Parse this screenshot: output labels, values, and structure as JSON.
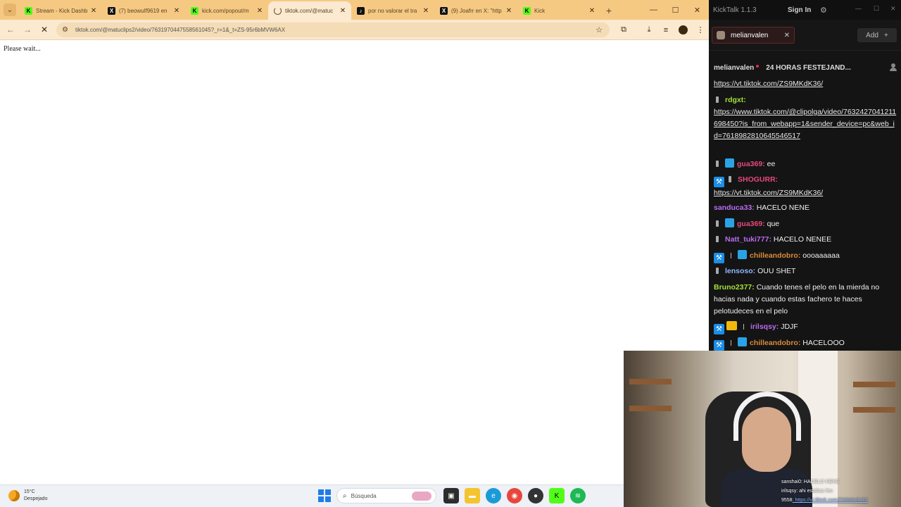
{
  "browser": {
    "tabs": [
      {
        "label": "Stream - Kick Dashb",
        "icon": "kick-icon"
      },
      {
        "label": "(7) beowulf9619 en",
        "icon": "x-icon"
      },
      {
        "label": "kick.com/popout/m",
        "icon": "kick-icon"
      },
      {
        "label": "tiktok.com/@matuc",
        "icon": "loading-icon",
        "active": true
      },
      {
        "label": "por no valorar el tra",
        "icon": "tiktok-icon"
      },
      {
        "label": "(9) Joafrr en X: \"http",
        "icon": "x-icon"
      },
      {
        "label": "Kick",
        "icon": "kick-icon"
      }
    ],
    "url": "tiktok.com/@matuclips2/video/7631970447558561045?_r=1&_t=ZS-95r6bMVW6AX",
    "page_text": "Please wait..."
  },
  "taskbar": {
    "weather_temp": "15°C",
    "weather_desc": "Despejado",
    "search_placeholder": "Búsqueda"
  },
  "kicktalk": {
    "app_title": "KickTalk 1.1.3",
    "sign_in": "Sign In",
    "channel_tab": "melianvalen",
    "add_label": "Add",
    "stream_channel": "melianvalen",
    "stream_title": "24 HORAS FESTEJAND...",
    "accent": "#53fc18",
    "messages": [
      {
        "user": "",
        "color": "#e8e8e8",
        "text": "https://vt.tiktok.com/ZS9MKdK36/"
      },
      {
        "user": "rdgxt:",
        "color": "#a2e23a",
        "text": "https://www.tiktok.com/@clipolga/video/7632427041211698450?is_from_webapp=1&sender_device=pc&web_id=7618982810645546517"
      },
      {
        "user": "gua369:",
        "color": "#e6487a",
        "text": "ee"
      },
      {
        "user": "SHOGURR:",
        "color": "#e6487a",
        "text": "https://vt.tiktok.com/ZS9MKdK36/"
      },
      {
        "user": "sanduca33:",
        "color": "#b86cf0",
        "text": "HACELO NENE"
      },
      {
        "user": "gua369:",
        "color": "#e6487a",
        "text": "que"
      },
      {
        "user": "Natt_tuki777:",
        "color": "#b86cf0",
        "text": "HACELO NENEE"
      },
      {
        "user": "chilleandobro:",
        "color": "#d98c3a",
        "text": "oooaaaaaa"
      },
      {
        "user": "lensoso:",
        "color": "#8fb8ff",
        "text": "OUU SHET"
      },
      {
        "user": "Bruno2377:",
        "color": "#a2e23a",
        "text": "Cuando tenes el pelo en la mierda no hacias nada y cuando estas fachero te haces pelotudeces en el pelo"
      },
      {
        "user": "irilsqsy:",
        "color": "#b86cf0",
        "text": "JDJF"
      },
      {
        "user": "chilleandobro:",
        "color": "#d98c3a",
        "text": "HACELOOO"
      }
    ]
  },
  "webcam": {
    "overlay_lines": [
      {
        "user": "sanshai0",
        "text": ": HACELO NENE"
      },
      {
        "user": "irilsqsy",
        "text": ": ahi estabas feo"
      },
      {
        "user": "9558",
        "text": ": https://vt.tiktok.com/ZS9MKdK36/"
      }
    ]
  }
}
